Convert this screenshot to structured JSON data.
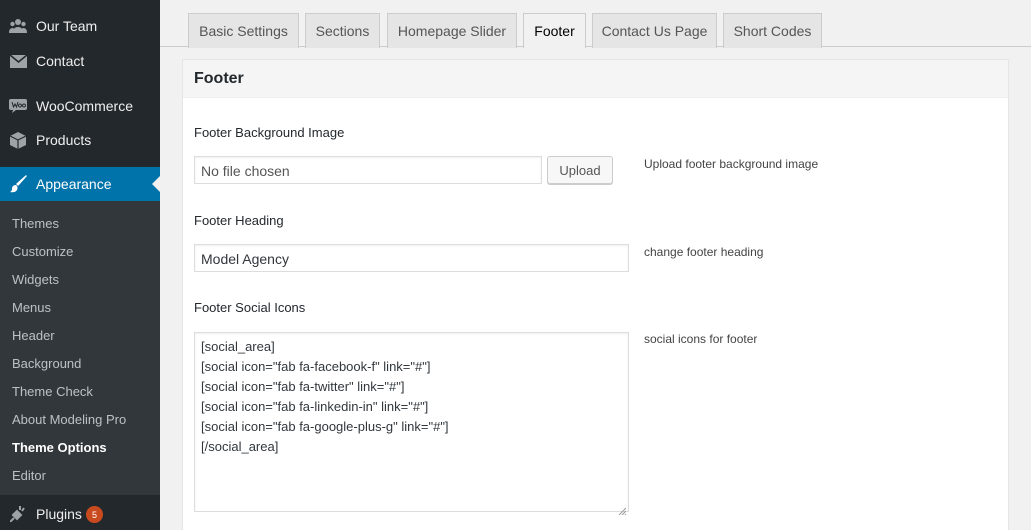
{
  "sidebar": {
    "menu": [
      {
        "label": "Our Team",
        "icon": "group-icon"
      },
      {
        "label": "Contact",
        "icon": "envelope-icon"
      },
      {
        "label": "WooCommerce",
        "icon": "woocommerce-icon"
      },
      {
        "label": "Products",
        "icon": "box-icon"
      },
      {
        "label": "Appearance",
        "icon": "paintbrush-icon"
      }
    ],
    "submenu": [
      "Themes",
      "Customize",
      "Widgets",
      "Menus",
      "Header",
      "Background",
      "Theme Check",
      "About Modeling Pro",
      "Theme Options",
      "Editor"
    ],
    "plugins": {
      "label": "Plugins",
      "icon": "plug-icon",
      "badge": "5"
    }
  },
  "tabs": [
    "Basic Settings",
    "Sections",
    "Homepage Slider",
    "Footer",
    "Contact Us Page",
    "Short Codes"
  ],
  "panel": {
    "title": "Footer",
    "bg_image": {
      "label": "Footer Background Image",
      "value": "No file chosen",
      "button": "Upload",
      "desc": "Upload footer background image"
    },
    "heading": {
      "label": "Footer Heading",
      "value": "Model Agency",
      "desc": "change footer heading"
    },
    "social": {
      "label": "Footer Social Icons",
      "desc": "social icons for footer",
      "lines": [
        "[social_area]",
        "[social icon=\"fab fa-facebook-f\" link=\"#\"]",
        "[social icon=\"fab fa-twitter\" link=\"#\"]",
        "[social icon=\"fab fa-linkedin-in\" link=\"#\"]",
        "[social icon=\"fab fa-google-plus-g\" link=\"#\"]",
        "[/social_area]"
      ]
    }
  },
  "colors": {
    "sidebar_bg": "#23282d",
    "submenu_bg": "#32373c",
    "accent": "#0073aa",
    "badge": "#ca4a1f"
  }
}
